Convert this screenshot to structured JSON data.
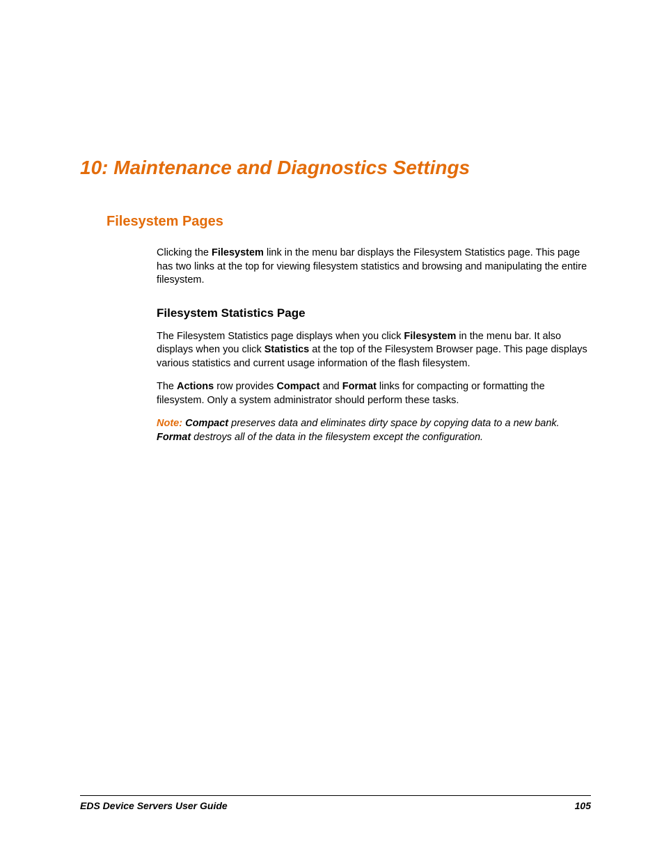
{
  "chapter": {
    "title": "10: Maintenance and Diagnostics Settings"
  },
  "section": {
    "title": "Filesystem Pages",
    "intro_1a": "Clicking the ",
    "intro_1b": "Filesystem",
    "intro_1c": " link in the menu bar displays the Filesystem Statistics page. This page has two links at the top for viewing filesystem statistics and browsing and manipulating the entire filesystem.",
    "subsection_title": "Filesystem Statistics Page",
    "p2a": "The Filesystem Statistics page displays when you click ",
    "p2b": "Filesystem",
    "p2c": " in the menu bar. It also displays when you click ",
    "p2d": "Statistics",
    "p2e": " at the top of the Filesystem Browser page. This page displays various statistics and current usage information of the flash filesystem.",
    "p3a": "The ",
    "p3b": "Actions",
    "p3c": " row provides ",
    "p3d": "Compact",
    "p3e": " and ",
    "p3f": "Format",
    "p3g": " links for compacting or formatting the filesystem. Only a system administrator should perform these tasks.",
    "note_label": "Note:",
    "note_1a": " ",
    "note_1b": "Compact",
    "note_1c": " preserves data and eliminates dirty space by copying data to a new bank. ",
    "note_1d": "Format",
    "note_1e": " destroys all of the data in the filesystem except the configuration."
  },
  "footer": {
    "guide": "EDS Device Servers User Guide",
    "page": "105"
  }
}
